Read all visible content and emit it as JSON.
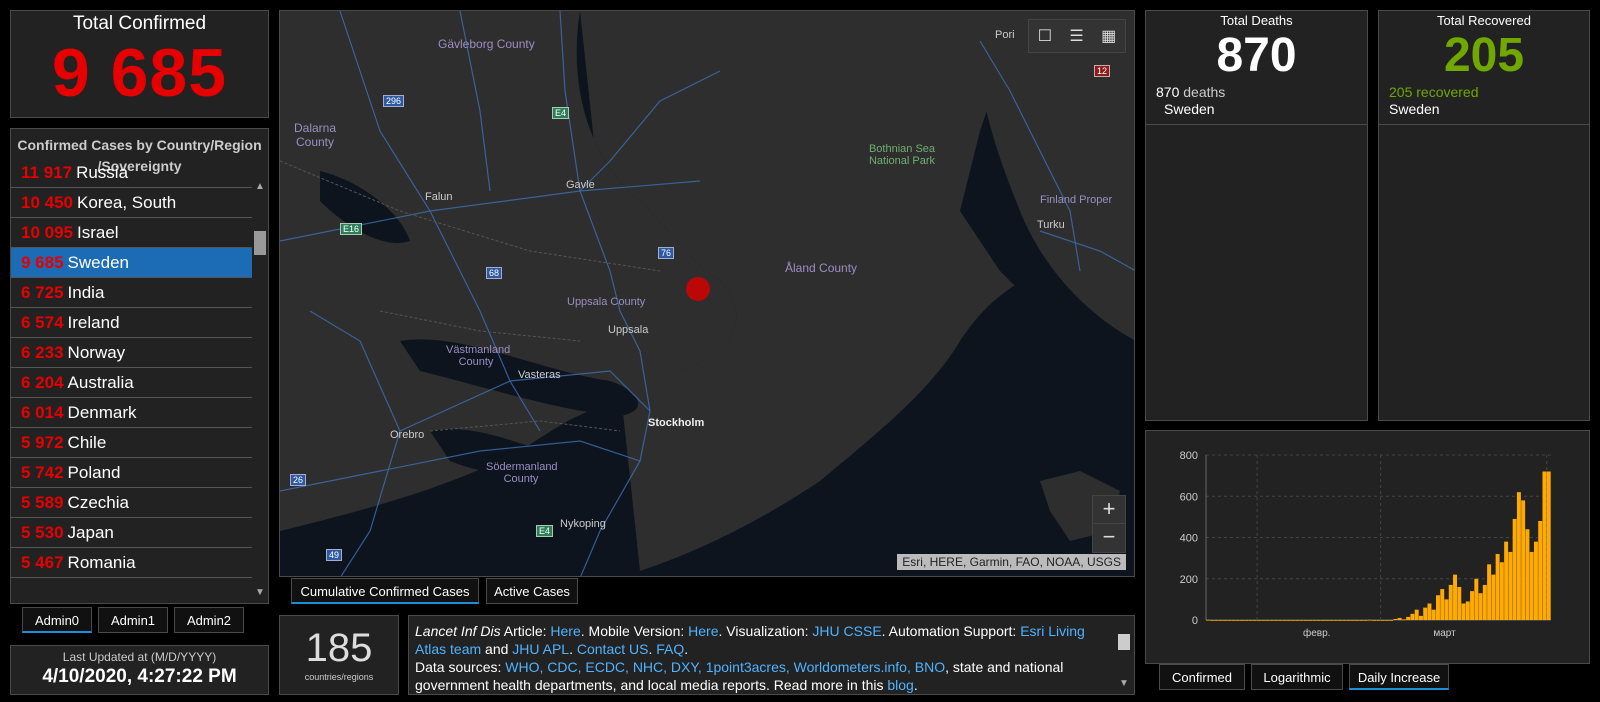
{
  "total_confirmed": {
    "title": "Total Confirmed",
    "value": "9 685"
  },
  "country_list": {
    "title": "Confirmed Cases by Country/Region /Sovereignty",
    "items": [
      {
        "count": "11 917",
        "name": "Russia"
      },
      {
        "count": "10 450",
        "name": "Korea, South"
      },
      {
        "count": "10 095",
        "name": "Israel"
      },
      {
        "count": "9 685",
        "name": "Sweden",
        "selected": true
      },
      {
        "count": "6 725",
        "name": "India"
      },
      {
        "count": "6 574",
        "name": "Ireland"
      },
      {
        "count": "6 233",
        "name": "Norway"
      },
      {
        "count": "6 204",
        "name": "Australia"
      },
      {
        "count": "6 014",
        "name": "Denmark"
      },
      {
        "count": "5 972",
        "name": "Chile"
      },
      {
        "count": "5 742",
        "name": "Poland"
      },
      {
        "count": "5 589",
        "name": "Czechia"
      },
      {
        "count": "5 530",
        "name": "Japan"
      },
      {
        "count": "5 467",
        "name": "Romania"
      }
    ]
  },
  "admin_tabs": [
    "Admin0",
    "Admin1",
    "Admin2"
  ],
  "last_updated": {
    "label": "Last Updated at (M/D/YYYY)",
    "value": "4/10/2020, 4:27:22 PM"
  },
  "map": {
    "labels": {
      "gavleborg": "Gävleborg County",
      "dalarna": "Dalarna County",
      "falun": "Falun",
      "gavle": "Gavle",
      "uppsala_county": "Uppsala County",
      "uppsala": "Uppsala",
      "vastmanland": "Västmanland County",
      "vasteras": "Vasteras",
      "orebro": "Orebro",
      "stockholm": "Stockholm",
      "sodermanland": "Södermanland County",
      "nykoping": "Nykoping",
      "aland": "Åland County",
      "bothnian": "Bothnian Sea National Park",
      "finland_proper": "Finland Proper",
      "turku": "Turku",
      "pori": "Pori",
      "r296": "296",
      "re4a": "E4",
      "re16": "E16",
      "r68": "68",
      "r76": "76",
      "r26": "26",
      "r49": "49",
      "re4b": "E4",
      "r12": "12"
    },
    "attribution": "Esri, HERE, Garmin, FAO, NOAA, USGS",
    "zoom_in": "+",
    "zoom_out": "−",
    "toolbar_icons": [
      "bookmark-icon",
      "list-icon",
      "qr-grid-icon"
    ]
  },
  "map_tabs": [
    "Cumulative Confirmed Cases",
    "Active Cases"
  ],
  "countries_count": {
    "value": "185",
    "label": "countries/regions"
  },
  "info": {
    "p1_a": "Lancet Inf Dis",
    "p1_b": " Article: ",
    "here1": "Here",
    "p1_c": ". Mobile Version: ",
    "here2": "Here",
    "p1_d": ". Visualization: ",
    "jhu_csse": "JHU CSSE",
    "p1_e": ". Automation Support: ",
    "esri": "Esri Living Atlas team",
    "p1_f": " and ",
    "jhu_apl": "JHU APL",
    "p1_g": ". ",
    "contact": "Contact US",
    "p1_h": ". ",
    "faq": "FAQ",
    "p1_i": ".",
    "ds_label": "Data sources: ",
    "sources": "WHO, CDC, ECDC, NHC, DXY, 1point3acres, Worldometers.info, BNO",
    "ds_rest": ", state and national government health departments, and local media reports.  Read more in this ",
    "blog": "blog",
    "end": "."
  },
  "deaths": {
    "title": "Total Deaths",
    "value": "870",
    "num": "870",
    "unit": "deaths",
    "country": "Sweden"
  },
  "recovered": {
    "title": "Total Recovered",
    "value": "205",
    "detail": "205 recovered",
    "country": "Sweden"
  },
  "chart_tabs": [
    "Confirmed",
    "Logarithmic",
    "Daily Increase"
  ],
  "colors": {
    "confirmed": "#e60000",
    "recovered": "#70a800",
    "selected": "#1b6bb5",
    "bars": "#ffaa00"
  },
  "chart_data": {
    "type": "bar",
    "title": "",
    "xlabel": "",
    "ylabel": "",
    "x_tick_labels": [
      "февр.",
      "март"
    ],
    "y_ticks": [
      0,
      200,
      400,
      600,
      800
    ],
    "ylim": [
      0,
      800
    ],
    "grid": true,
    "series": [
      {
        "values": [
          1,
          0,
          0,
          0,
          0,
          0,
          0,
          0,
          0,
          0,
          0,
          0,
          0,
          0,
          0,
          0,
          0,
          0,
          0,
          0,
          0,
          0,
          0,
          0,
          0,
          0,
          0,
          0,
          0,
          0,
          0,
          0,
          0,
          0,
          0,
          0,
          0,
          0,
          1,
          0,
          0,
          0,
          0,
          0,
          5,
          10,
          3,
          15,
          30,
          50,
          20,
          60,
          80,
          50,
          120,
          150,
          100,
          170,
          220,
          160,
          80,
          90,
          140,
          200,
          130,
          170,
          270,
          220,
          320,
          280,
          380,
          330,
          490,
          620,
          580,
          440,
          330,
          380,
          480,
          720,
          720
        ]
      }
    ]
  }
}
